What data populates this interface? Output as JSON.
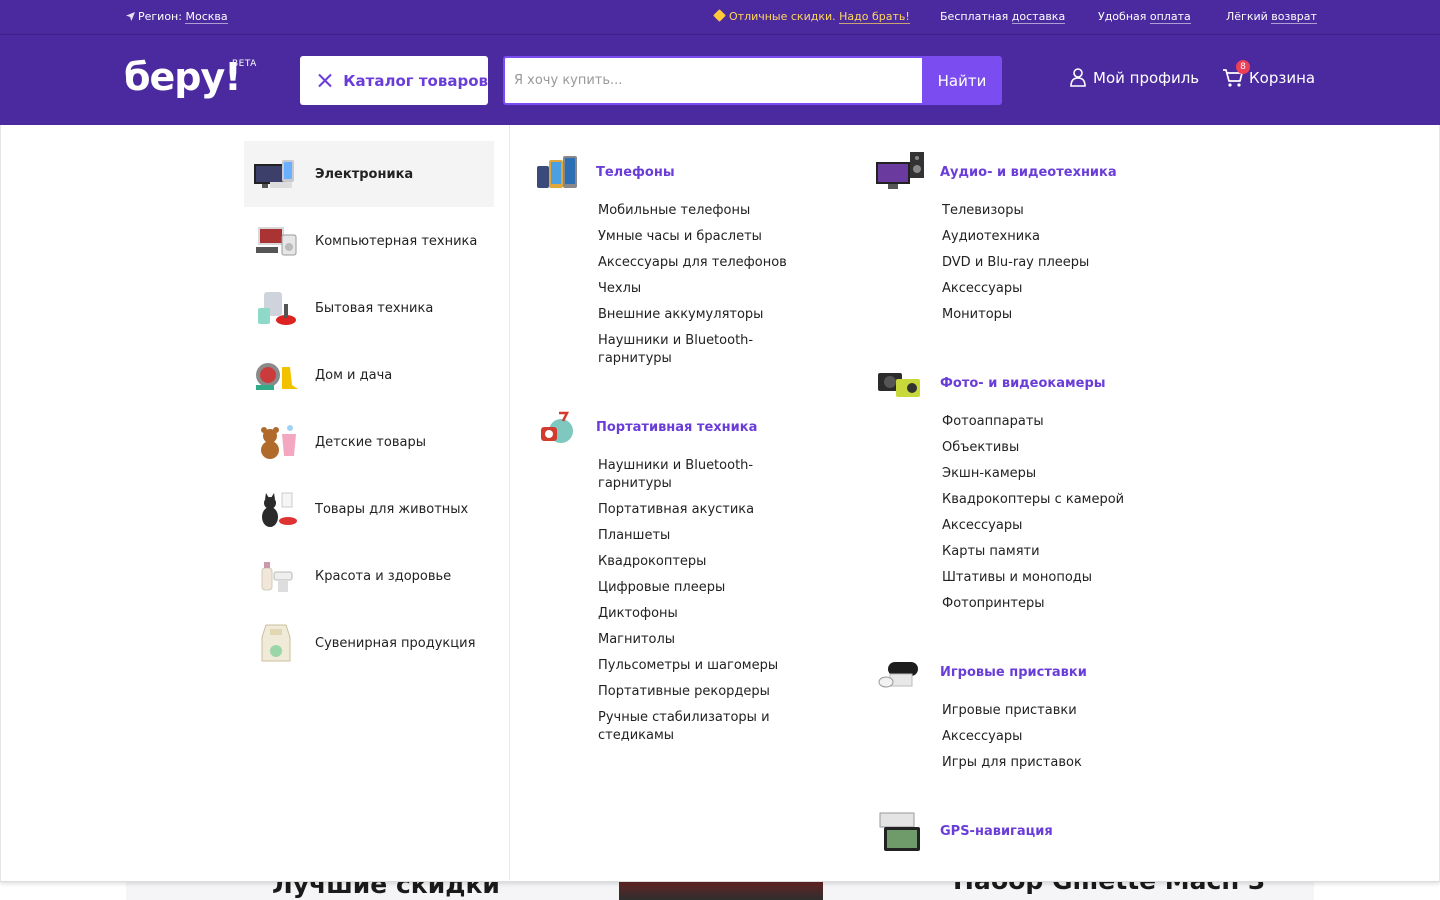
{
  "topbar": {
    "region_prefix": "Регион:",
    "region_city": "Москва",
    "promo_text": "Отличные скидки.",
    "promo_link": "Надо брать!",
    "delivery_prefix": "Бесплатная",
    "delivery_link": "доставка",
    "payment_prefix": "Удобная",
    "payment_link": "оплата",
    "return_prefix": "Лёгкий",
    "return_link": "возврат"
  },
  "header": {
    "logo": "беру!",
    "beta": "BETA",
    "catalog_label": "Каталог товаров",
    "search_placeholder": "Я хочу купить...",
    "search_value": "",
    "find_label": "Найти",
    "profile_label": "Мой профиль",
    "cart_label": "Корзина",
    "cart_count": "8"
  },
  "colors": {
    "header_bg": "#4a2a9e",
    "accent": "#7b4cf0",
    "link_accent": "#6a3dd9",
    "badge": "#ee3f58",
    "promo": "#ffd75e"
  },
  "categories": [
    {
      "label": "Электроника",
      "icon": "electronics-icon",
      "active": true
    },
    {
      "label": "Компьютерная техника",
      "icon": "computer-icon",
      "active": false
    },
    {
      "label": "Бытовая техника",
      "icon": "appliances-icon",
      "active": false
    },
    {
      "label": "Дом и дача",
      "icon": "home-garden-icon",
      "active": false
    },
    {
      "label": "Детские товары",
      "icon": "kids-icon",
      "active": false
    },
    {
      "label": "Товары для животных",
      "icon": "pets-icon",
      "active": false
    },
    {
      "label": "Красота и здоровье",
      "icon": "beauty-icon",
      "active": false
    },
    {
      "label": "Сувенирная продукция",
      "icon": "souvenir-icon",
      "active": false
    }
  ],
  "groups": {
    "phones": {
      "title": "Телефоны",
      "icon": "phones-icon",
      "items": [
        "Мобильные телефоны",
        "Умные часы и браслеты",
        "Аксессуары для телефонов",
        "Чехлы",
        "Внешние аккумуляторы",
        "Наушники и Bluetooth-гарнитуры"
      ]
    },
    "portable": {
      "title": "Портативная техника",
      "icon": "portable-tech-icon",
      "items": [
        "Наушники и Bluetooth-гарнитуры",
        "Портативная акустика",
        "Планшеты",
        "Квадрокоптеры",
        "Цифровые плееры",
        "Диктофоны",
        "Магнитолы",
        "Пульсометры и шагомеры",
        "Портативные рекордеры",
        "Ручные стабилизаторы и стедикамы"
      ]
    },
    "audio_video": {
      "title": "Аудио- и видеотехника",
      "icon": "audio-video-icon",
      "items": [
        "Телевизоры",
        "Аудиотехника",
        "DVD и Blu-ray плееры",
        "Аксессуары",
        "Мониторы"
      ]
    },
    "cameras": {
      "title": "Фото- и видеокамеры",
      "icon": "camera-icon",
      "items": [
        "Фотоаппараты",
        "Объективы",
        "Экшн-камеры",
        "Квадрокоптеры с камерой",
        "Аксессуары",
        "Карты памяти",
        "Штативы и моноподы",
        "Фотопринтеры"
      ]
    },
    "consoles": {
      "title": "Игровые приставки",
      "icon": "game-console-icon",
      "items": [
        "Игровые приставки",
        "Аксессуары",
        "Игры для приставок"
      ]
    },
    "gps": {
      "title": "GPS-навигация",
      "icon": "gps-navigator-icon",
      "items": []
    }
  },
  "background": {
    "deals_heading": "Лучшие скидки",
    "product_heading": "Набор Gillette Mach 3"
  }
}
